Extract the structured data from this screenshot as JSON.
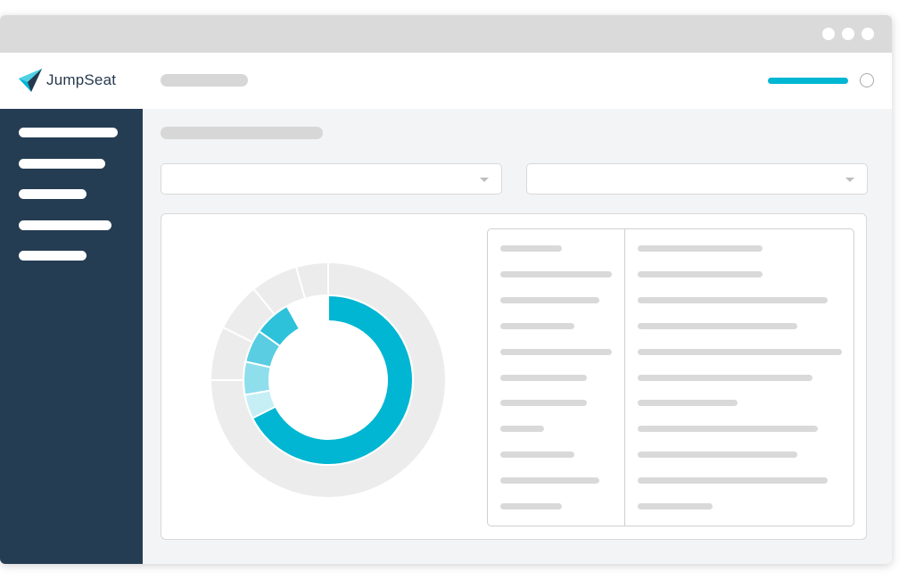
{
  "app": {
    "brand_name": "JumpSeat",
    "brand_icon": "paper-plane-icon",
    "colors": {
      "accent": "#00b6d2",
      "sidebar": "#253d53",
      "placeholder": "#d9d9d9"
    }
  },
  "window": {
    "controls": [
      "window-dot",
      "window-dot",
      "window-dot"
    ]
  },
  "header": {
    "progress_fraction": 1.0,
    "status_icon": "circle-icon"
  },
  "sidebar": {
    "item_count": 5
  },
  "filters": {
    "dropdowns": [
      {
        "value": "",
        "icon": "chevron-down-icon"
      },
      {
        "value": "",
        "icon": "chevron-down-icon"
      }
    ]
  },
  "chart_data": {
    "type": "pie",
    "inner_ring": {
      "values": [
        0.676,
        0.046,
        0.063,
        0.063,
        0.071
      ],
      "remainder": 0.081,
      "colors": [
        "#00b6d2",
        "#c6eef5",
        "#8fdeec",
        "#5acde2",
        "#2dc1da"
      ]
    },
    "outer_ring": {
      "values": [
        0.75,
        0.074,
        0.067,
        0.065,
        0.044
      ],
      "colors": [
        "#ececec",
        "#ececec",
        "#ececec",
        "#ececec",
        "#ececec"
      ]
    }
  }
}
